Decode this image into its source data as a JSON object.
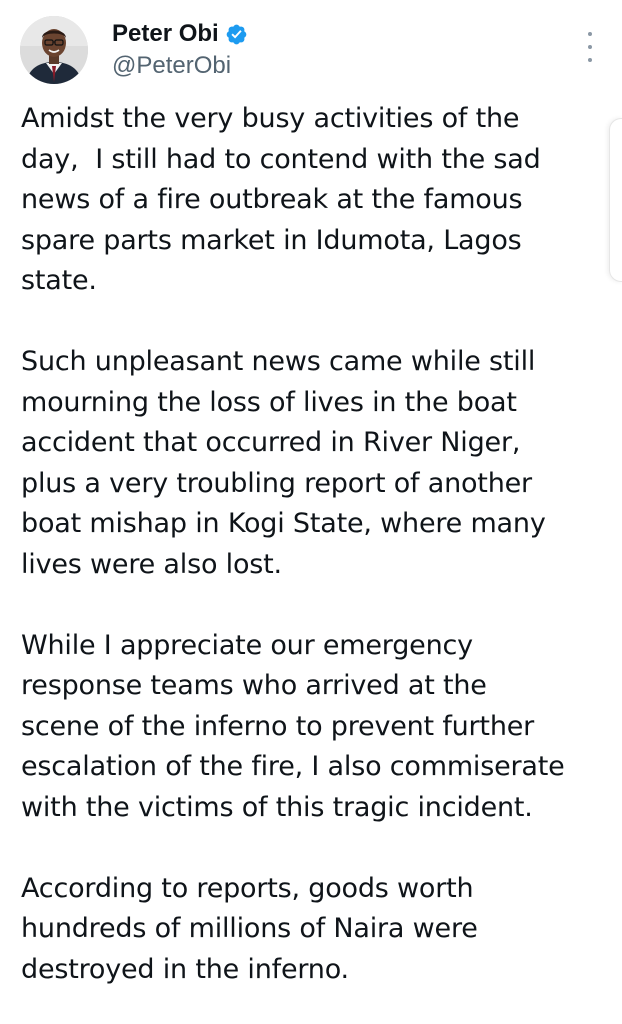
{
  "tweet": {
    "author": {
      "display_name": "Peter Obi",
      "handle": "@PeterObi",
      "verified": true,
      "avatar_icon": "profile-photo"
    },
    "more_icon": "vertical-ellipsis-icon",
    "paragraphs": [
      "Amidst the very busy activities of the\nday,  I still had to contend with the sad\nnews of a fire outbreak at the famous\nspare parts market in Idumota, Lagos\nstate.",
      "Such unpleasant news came while still\nmourning the loss of lives in the boat\naccident that occurred in River Niger,\nplus a very troubling report of another\nboat mishap in Kogi State, where many\nlives were also lost.",
      "While I appreciate our emergency\nresponse teams who arrived at the\nscene of the inferno to prevent further\nescalation of the fire, I also commiserate\nwith the victims of this tragic incident.",
      "According to reports, goods worth\nhundreds of millions of Naira were\ndestroyed in the inferno."
    ]
  },
  "colors": {
    "text_primary": "#0f1419",
    "text_secondary": "#536471",
    "verified_blue": "#1d9bf0",
    "background": "#ffffff"
  }
}
